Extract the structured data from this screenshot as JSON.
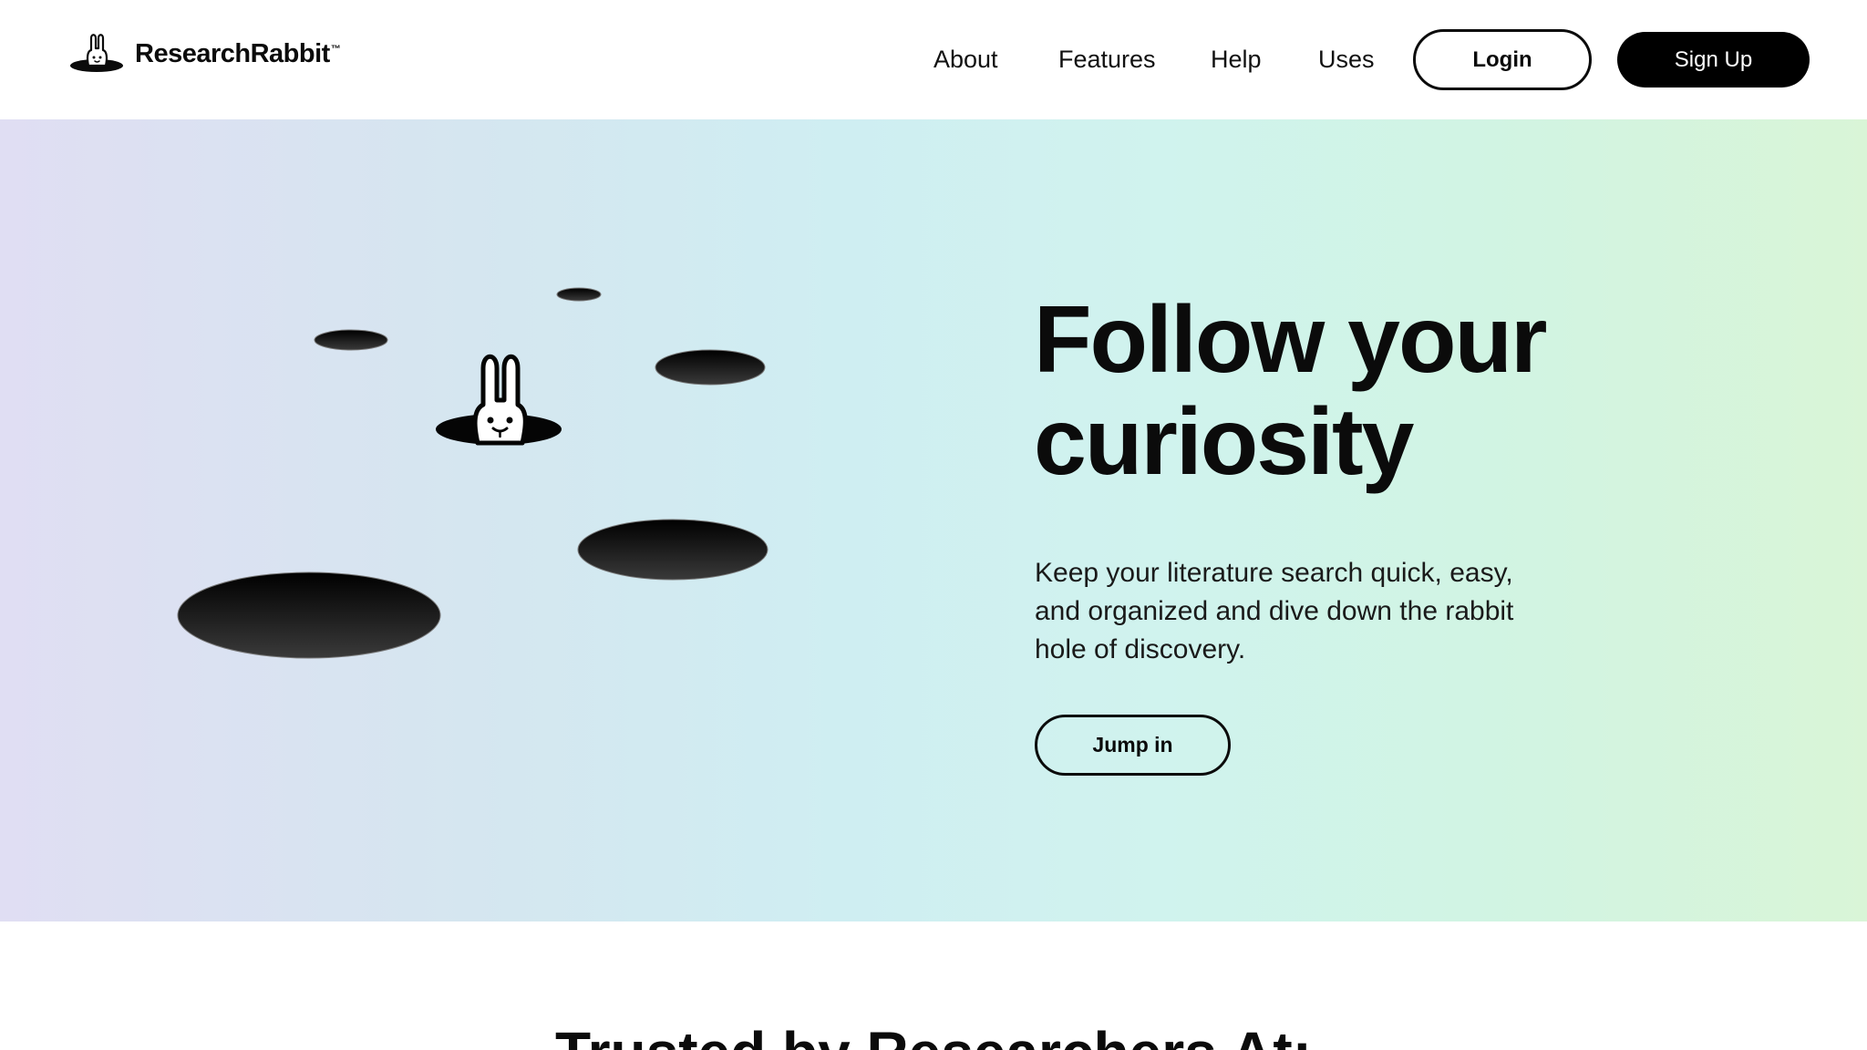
{
  "header": {
    "logo_text": "ResearchRabbit",
    "logo_tm": "™",
    "nav": [
      {
        "label": "About"
      },
      {
        "label": "Features"
      },
      {
        "label": "Help"
      },
      {
        "label": "Uses"
      }
    ],
    "login_label": "Login",
    "signup_label": "Sign Up"
  },
  "hero": {
    "title_line1": "Follow your",
    "title_line2": "curiosity",
    "subtitle": "Keep your literature search quick, easy, and organized and dive down the rabbit hole of discovery.",
    "cta_label": "Jump in"
  },
  "trusted": {
    "title": "Trusted by Researchers At:"
  },
  "colors": {
    "text": "#0b0b0b",
    "signup_bg": "#000000",
    "hero_gradient_start": "#e0def3",
    "hero_gradient_mid": "#cfeef2",
    "hero_gradient_end": "#d9f5d7"
  },
  "icons": {
    "logo": "rabbit-in-hole-icon"
  }
}
